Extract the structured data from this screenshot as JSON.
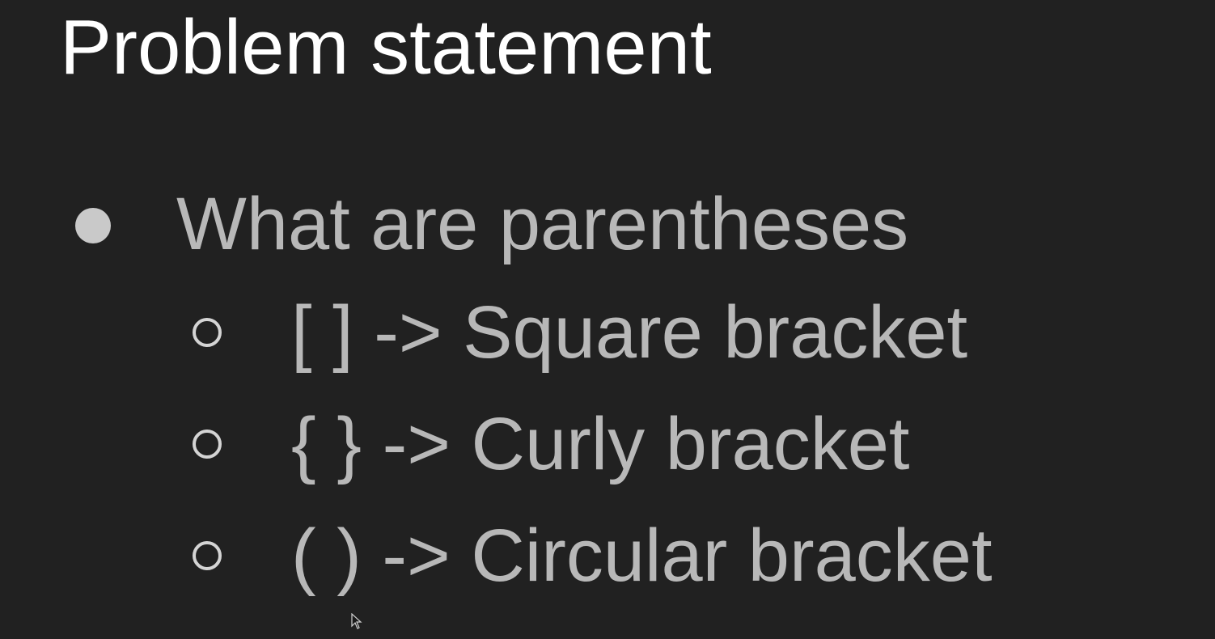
{
  "slide": {
    "title": "Problem statement",
    "bullet": "What are parentheses",
    "sub_items": [
      {
        "text": "[ ] -> Square bracket"
      },
      {
        "text": "{ } -> Curly bracket"
      },
      {
        "text": "( ) -> Circular bracket"
      }
    ]
  },
  "colors": {
    "background": "#212121",
    "title": "#ffffff",
    "body": "#b8b8b8"
  },
  "icons": {
    "bullet_level1": "filled-circle",
    "bullet_level2": "hollow-circle",
    "cursor": "mouse-pointer-icon"
  }
}
